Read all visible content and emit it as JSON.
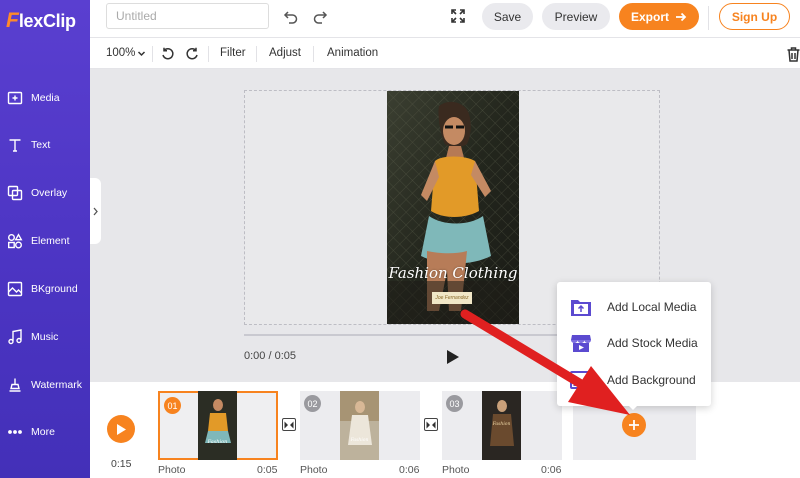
{
  "app": {
    "logo_initial": "F",
    "logo_rest": "lexClip"
  },
  "sidebar": {
    "items": [
      {
        "label": "Media",
        "icon": "media-icon"
      },
      {
        "label": "Text",
        "icon": "text-icon"
      },
      {
        "label": "Overlay",
        "icon": "overlay-icon"
      },
      {
        "label": "Element",
        "icon": "element-icon"
      },
      {
        "label": "BKground",
        "icon": "background-icon"
      },
      {
        "label": "Music",
        "icon": "music-icon"
      },
      {
        "label": "Watermark",
        "icon": "watermark-icon"
      },
      {
        "label": "More",
        "icon": "more-icon"
      }
    ]
  },
  "header": {
    "title_placeholder": "Untitled",
    "save_label": "Save",
    "preview_label": "Preview",
    "export_label": "Export",
    "signup_label": "Sign Up"
  },
  "toolbar": {
    "zoom": "100%",
    "filter_label": "Filter",
    "adjust_label": "Adjust",
    "animation_label": "Animation"
  },
  "canvas": {
    "overlay_title": "Fashion Clothing",
    "overlay_tag": "Joe Fernandez",
    "time_display": "0:00 / 0:05"
  },
  "popup": {
    "items": [
      {
        "label": "Add Local Media",
        "icon": "upload-folder-icon"
      },
      {
        "label": "Add Stock Media",
        "icon": "stock-store-icon"
      },
      {
        "label": "Add Background",
        "icon": "background-image-icon"
      }
    ]
  },
  "timeline": {
    "total_time": "0:15",
    "clips": [
      {
        "num": "01",
        "type": "Photo",
        "duration": "0:05"
      },
      {
        "num": "02",
        "type": "Photo",
        "duration": "0:06"
      },
      {
        "num": "03",
        "type": "Photo",
        "duration": "0:06"
      }
    ]
  },
  "colors": {
    "accent": "#f7831f",
    "sidebar": "#4b34c2",
    "arrow": "#e02020"
  }
}
